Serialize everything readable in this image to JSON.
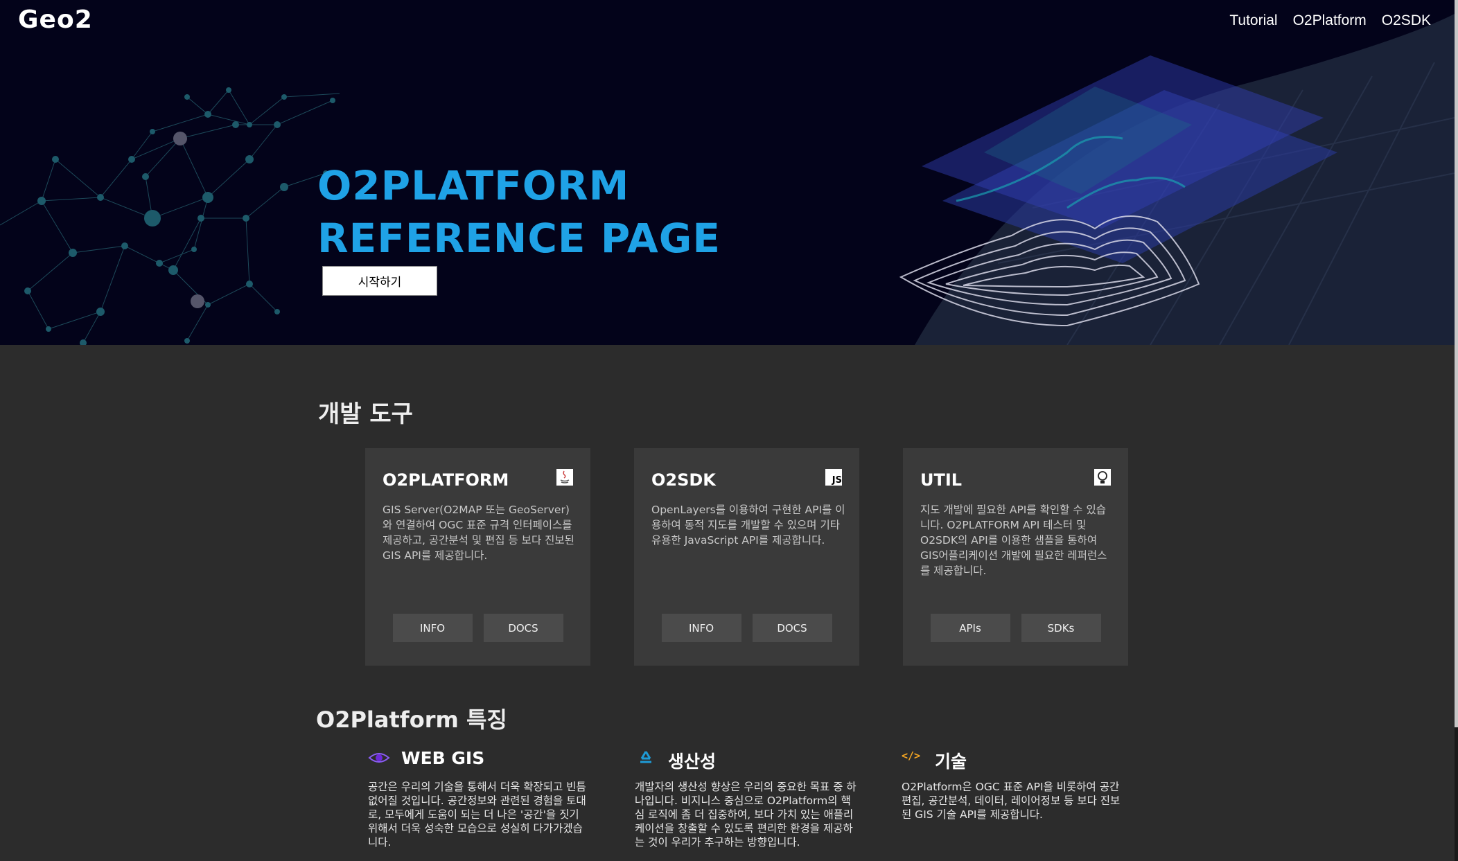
{
  "header": {
    "logo_text": "Geo2",
    "nav": [
      "Tutorial",
      "O2Platform",
      "O2SDK"
    ]
  },
  "hero": {
    "title_line1": "O2PLATFORM",
    "title_line2": "REFERENCE PAGE",
    "start_button": "시작하기"
  },
  "dev_tools": {
    "title": "개발 도구",
    "cards": [
      {
        "title": "O2PLATFORM",
        "icon": "java-icon",
        "description": "GIS Server(O2MAP 또는 GeoServer)와 연결하여 OGC 표준 규격 인터페이스를 제공하고, 공간분석 및 편집 등 보다 진보된 GIS API를 제공합니다.",
        "buttons": [
          "INFO",
          "DOCS"
        ]
      },
      {
        "title": "O2SDK",
        "icon": "js-icon",
        "icon_text": "JS",
        "description": "OpenLayers를 이용하여 구현한 API를 이용하여 동적 지도를 개발할 수 있으며 기타 유용한 JavaScript API를 제공합니다.",
        "buttons": [
          "INFO",
          "DOCS"
        ]
      },
      {
        "title": "UTIL",
        "icon": "lightbulb-icon",
        "description": "지도 개발에 필요한 API를 확인할 수 있습니다. O2PLATFORM API 테스터 및 O2SDK의 API를 이용한 샘플을 통하여 GIS어플리케이션 개발에 필요한 레퍼런스를 제공합니다.",
        "buttons": [
          "APIs",
          "SDKs"
        ]
      }
    ]
  },
  "features": {
    "title": "O2Platform 특징",
    "items": [
      {
        "title": "WEB GIS",
        "icon": "eye-icon",
        "description": "공간은 우리의 기술을 통해서 더욱 확장되고 빈틈없어질 것입니다. 공간정보와 관련된 경험을 토대로, 모두에게 도움이 되는 더 나은 '공간'을 짓기 위해서 더욱 성숙한 모습으로 성실히 다가가겠습니다."
      },
      {
        "title": "생산성",
        "icon": "recycle-icon",
        "description": "개발자의 생산성 향상은 우리의 중요한 목표 중 하나입니다. 비지니스 중심으로 O2Platform의 핵심 로직에 좀 더 집중하여, 보다 가치 있는 애플리케이션을 창출할 수 있도록 편리한 환경을 제공하는 것이 우리가 추구하는 방향입니다."
      },
      {
        "title": "기술",
        "icon": "code-icon",
        "icon_text": "</>",
        "description": "O2Platform은 OGC 표준 API을 비롯하여 공간편집, 공간분석, 데이터, 레이어정보 등 보다 진보된 GIS 기술 API를 제공합니다."
      }
    ]
  },
  "colors": {
    "hero_bg": "#03031a",
    "accent": "#1fa2e6",
    "content_bg": "#2c2c2c",
    "card_bg": "#3a3a3a"
  }
}
